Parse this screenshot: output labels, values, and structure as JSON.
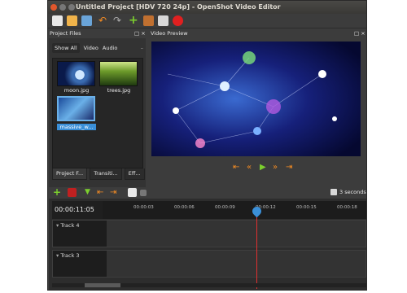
{
  "window": {
    "title": "Untitled Project [HDV 720 24p] - OpenShot Video Editor"
  },
  "toolbar": {
    "icons": [
      "new-project-icon",
      "open-project-icon",
      "save-project-icon",
      "undo-icon",
      "redo-icon",
      "add-file-icon",
      "export-icon",
      "fullscreen-icon",
      "record-icon"
    ]
  },
  "project_files": {
    "header": "Project Files",
    "close_symbol": "□ ×",
    "tabs": [
      "Show All",
      "Video",
      "Audio"
    ],
    "files": [
      {
        "name": "moon.jpg"
      },
      {
        "name": "trees.jpg"
      },
      {
        "name": "massive_w..."
      }
    ]
  },
  "bottom_tabs": [
    "Project F...",
    "Transiti...",
    "Eff..."
  ],
  "video_preview": {
    "header": "Video Preview",
    "close_symbol": "□ ×"
  },
  "timeline": {
    "timecode": "00:00:11:05",
    "zoom_label": "3 seconds",
    "ticks": [
      "00:00:03",
      "00:00:06",
      "00:00:09",
      "00:00:12",
      "00:00:15",
      "00:00:18"
    ],
    "tracks": [
      "Track 4",
      "Track 3"
    ]
  },
  "colors": {
    "accent": "#3a8fd8",
    "orange": "#f08a24",
    "green": "#7ccf2e",
    "playline": "#e03030"
  }
}
